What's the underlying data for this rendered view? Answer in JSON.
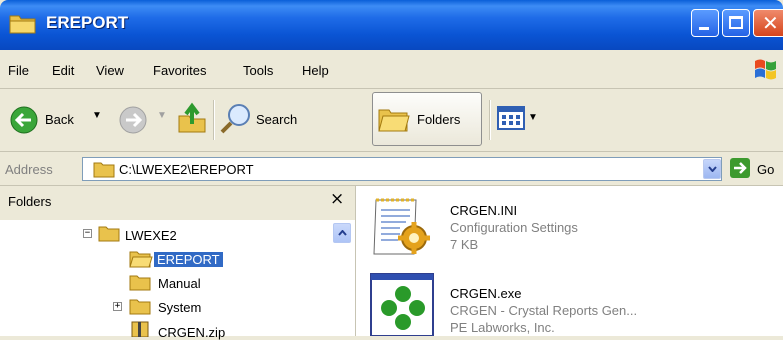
{
  "window": {
    "title": "EREPORT",
    "close_glyph": "✕"
  },
  "menu": [
    "File",
    "Edit",
    "View",
    "Favorites",
    "Tools",
    "Help"
  ],
  "toolbar": {
    "back_label": "Back",
    "search_label": "Search",
    "folders_label": "Folders"
  },
  "address": {
    "label": "Address",
    "value": "C:\\LWEXE2\\EREPORT",
    "go_label": "Go"
  },
  "folders_pane": {
    "title": "Folders",
    "close_glyph": "×",
    "tree": [
      {
        "label": "LWEXE2",
        "expander": "−"
      },
      {
        "label": "EREPORT",
        "selected": true
      },
      {
        "label": "Manual"
      },
      {
        "label": "System",
        "expander": "+"
      },
      {
        "label": "CRGEN.zip"
      }
    ]
  },
  "files": [
    {
      "name": "CRGEN.INI",
      "line2": "Configuration Settings",
      "line3": "7 KB",
      "icon": "config-settings-icon"
    },
    {
      "name": "CRGEN.exe",
      "line2": "CRGEN - Crystal Reports Gen...",
      "line3": "PE Labworks, Inc.",
      "icon": "crystal-reports-icon"
    }
  ],
  "colors": {
    "titlebar": "#0a54d4",
    "selection": "#316ac5",
    "close_button": "#d5451c",
    "go_button": "#3d9a2e"
  }
}
